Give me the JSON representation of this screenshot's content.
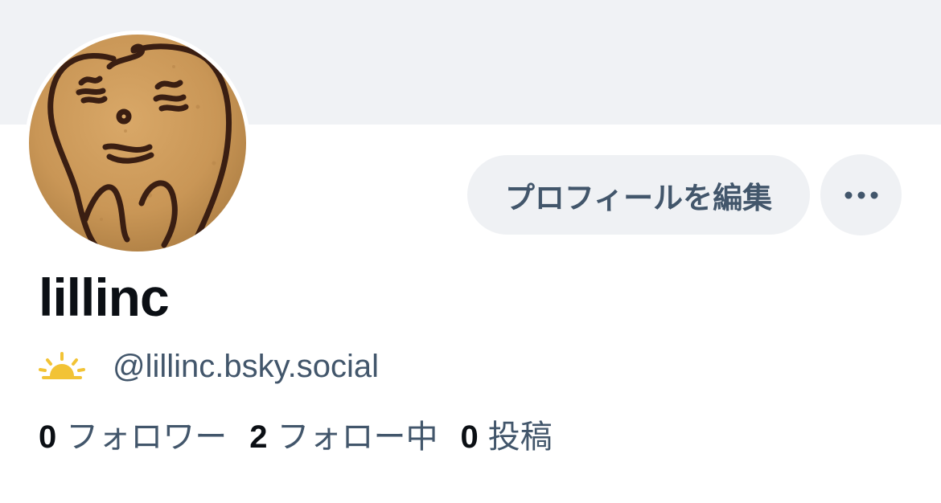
{
  "profile": {
    "display_name": "lillinc",
    "handle": "@lillinc.bsky.social",
    "status_icon": "sunrise-icon"
  },
  "actions": {
    "edit_profile_label": "プロフィールを編集",
    "more_icon": "ellipsis-icon"
  },
  "stats": {
    "followers_count": "0",
    "followers_label": "フォロワー",
    "following_count": "2",
    "following_label": "フォロー中",
    "posts_count": "0",
    "posts_label": "投稿"
  },
  "colors": {
    "banner": "#f0f2f5",
    "button_bg": "#eff1f4",
    "secondary_text": "#42566b",
    "primary_text": "#0b0f14",
    "sun_accent": "#f2c335"
  }
}
